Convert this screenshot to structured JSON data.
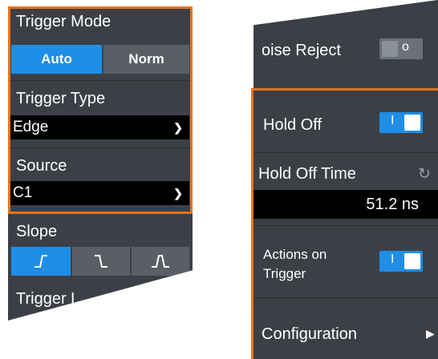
{
  "left_panel": {
    "trigger_mode_label": "Trigger Mode",
    "mode_options": [
      "Auto",
      "Norm"
    ],
    "trigger_type_label": "Trigger Type",
    "trigger_type_value": "Edge",
    "source_label": "Source",
    "source_value": "C1",
    "slope_label": "Slope",
    "trigger_level_label_partial": "Trigger L"
  },
  "right_panel": {
    "noise_reject_label_partial": "oise Reject",
    "hold_off_label": "Hold Off",
    "hold_off_time_label": "Hold Off Time",
    "hold_off_time_value": "51.2 ns",
    "actions_on_trigger_line1": "Actions on",
    "actions_on_trigger_line2": "Trigger",
    "configuration_label": "Configuration"
  },
  "colors": {
    "accent": "#1e8ee6",
    "highlight_border": "#e8731a",
    "panel_bg": "#3c4046"
  }
}
